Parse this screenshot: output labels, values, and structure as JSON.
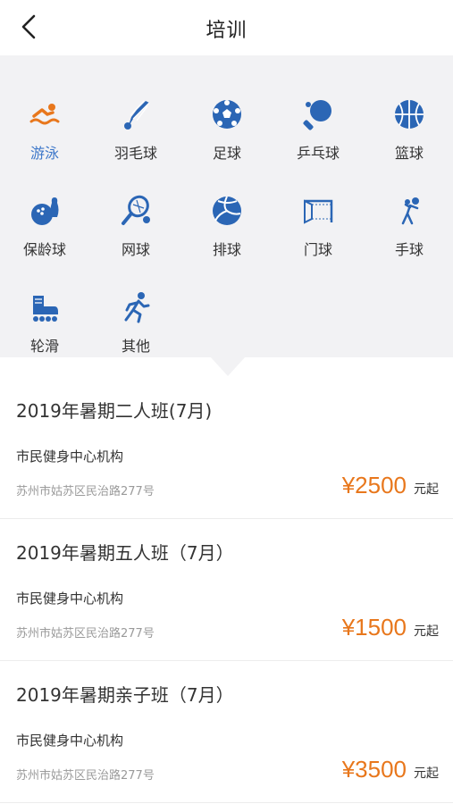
{
  "header": {
    "title": "培训",
    "back_icon": "chevron-left-icon"
  },
  "colors": {
    "accent": "#3d77c9",
    "price": "#e8771c",
    "panel_bg": "#f2f2f4"
  },
  "categories": [
    {
      "label": "游泳",
      "icon": "swimming-icon",
      "active": true
    },
    {
      "label": "羽毛球",
      "icon": "shuttlecock-icon"
    },
    {
      "label": "足球",
      "icon": "soccer-ball-icon"
    },
    {
      "label": "乒乓球",
      "icon": "ping-pong-icon"
    },
    {
      "label": "篮球",
      "icon": "basketball-icon"
    },
    {
      "label": "保龄球",
      "icon": "bowling-icon"
    },
    {
      "label": "网球",
      "icon": "tennis-icon"
    },
    {
      "label": "排球",
      "icon": "volleyball-icon"
    },
    {
      "label": "门球",
      "icon": "gate-ball-icon"
    },
    {
      "label": "手球",
      "icon": "handball-icon"
    },
    {
      "label": "轮滑",
      "icon": "roller-skate-icon"
    },
    {
      "label": "其他",
      "icon": "running-icon"
    }
  ],
  "courses": [
    {
      "title": "2019年暑期二人班(7月)",
      "org": "市民健身中心机构",
      "address": "苏州市姑苏区民治路277号",
      "price": "¥2500",
      "unit": "元起"
    },
    {
      "title": "2019年暑期五人班（7月）",
      "org": "市民健身中心机构",
      "address": "苏州市姑苏区民治路277号",
      "price": "¥1500",
      "unit": "元起"
    },
    {
      "title": "2019年暑期亲子班（7月）",
      "org": "市民健身中心机构",
      "address": "苏州市姑苏区民治路277号",
      "price": "¥3500",
      "unit": "元起"
    }
  ]
}
